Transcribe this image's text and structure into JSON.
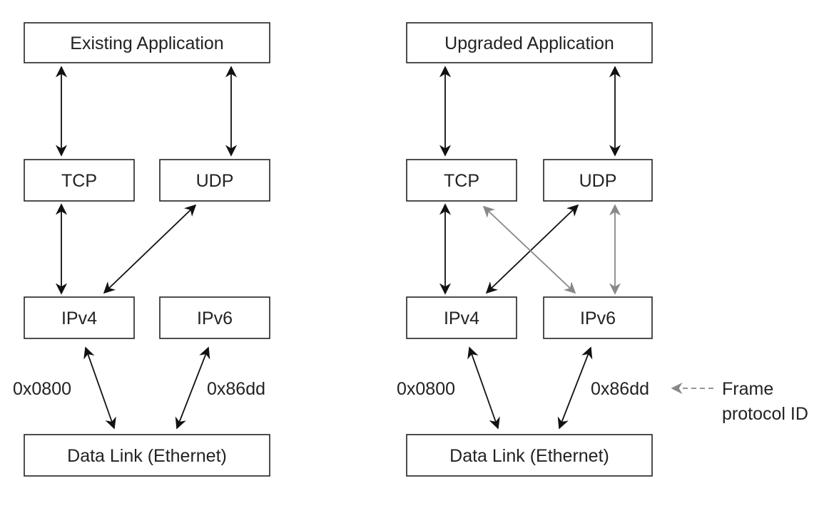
{
  "left": {
    "application": "Existing Application",
    "tcp": "TCP",
    "udp": "UDP",
    "ipv4": "IPv4",
    "ipv6": "IPv6",
    "datalink": "Data Link (Ethernet)",
    "ipv4_id": "0x0800",
    "ipv6_id": "0x86dd"
  },
  "right": {
    "application": "Upgraded Application",
    "tcp": "TCP",
    "udp": "UDP",
    "ipv4": "IPv4",
    "ipv6": "IPv6",
    "datalink": "Data Link (Ethernet)",
    "ipv4_id": "0x0800",
    "ipv6_id": "0x86dd",
    "annotation_line1": "Frame",
    "annotation_line2": "protocol ID"
  },
  "colors": {
    "primary_arrow": "#111111",
    "new_path_arrow": "#888888"
  }
}
